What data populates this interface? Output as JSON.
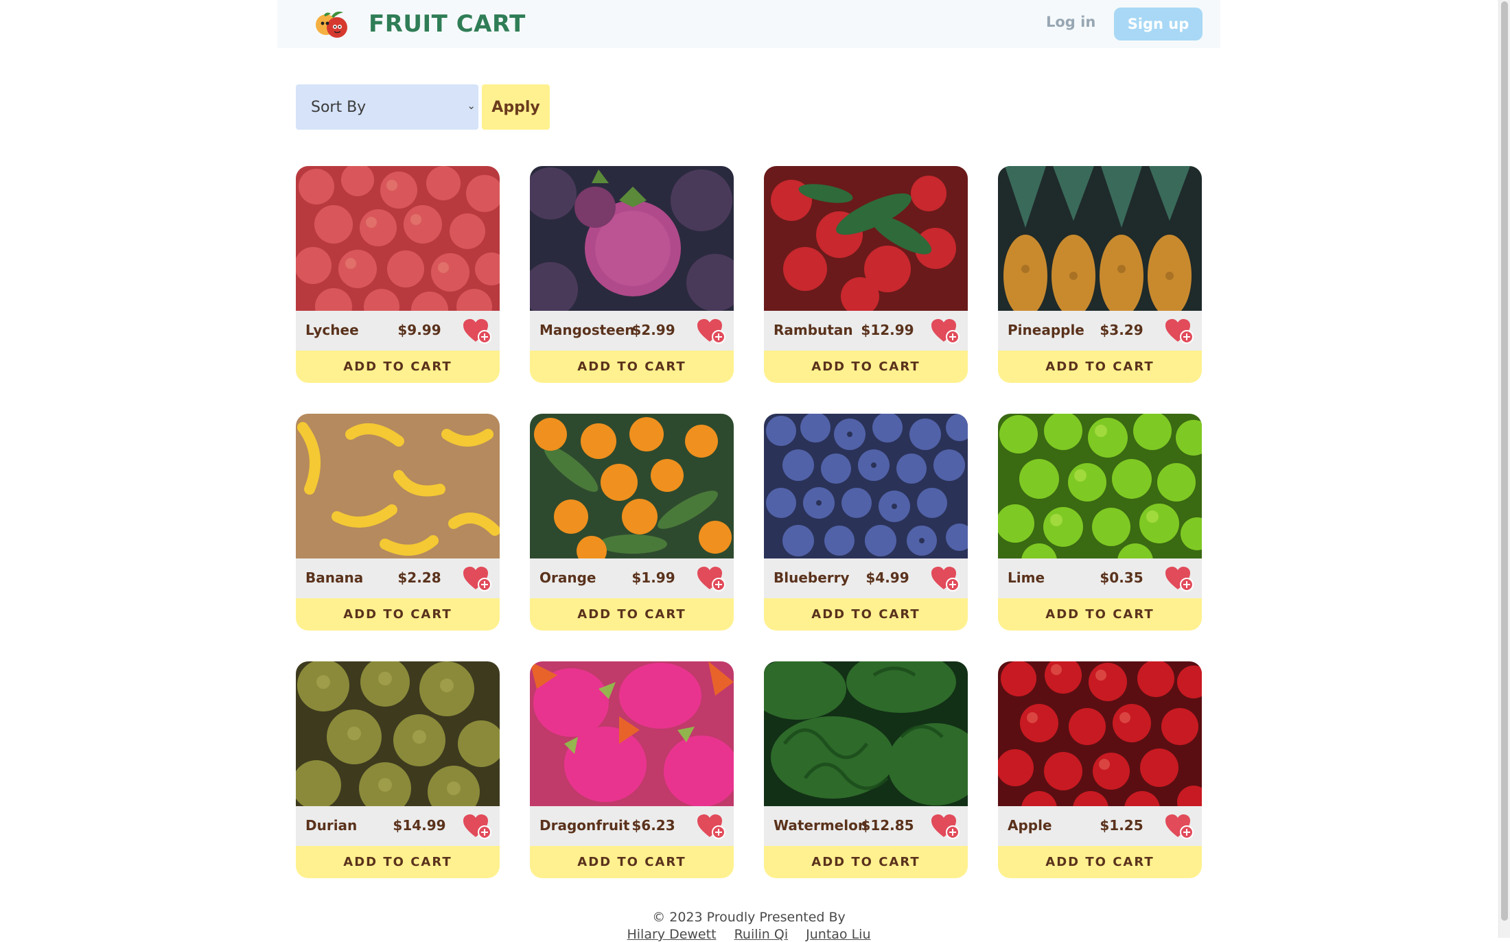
{
  "header": {
    "brand": "FRUIT CART",
    "login_label": "Log in",
    "signup_label": "Sign up"
  },
  "controls": {
    "sort_value": "Sort By",
    "apply_label": "Apply"
  },
  "colors": {
    "brand": "#2f7d56",
    "accent_yellow": "#fff18f",
    "signup_blue": "#a8d8f5",
    "text_brown": "#5a321c",
    "heart_red": "#e14b5a"
  },
  "products": [
    {
      "name": "Lychee",
      "price": "$9.99",
      "cart_label": "ADD TO CART"
    },
    {
      "name": "Mangosteen",
      "price": "$2.99",
      "cart_label": "ADD TO CART"
    },
    {
      "name": "Rambutan",
      "price": "$12.99",
      "cart_label": "ADD TO CART"
    },
    {
      "name": "Pineapple",
      "price": "$3.29",
      "cart_label": "ADD TO CART"
    },
    {
      "name": "Banana",
      "price": "$2.28",
      "cart_label": "ADD TO CART"
    },
    {
      "name": "Orange",
      "price": "$1.99",
      "cart_label": "ADD TO CART"
    },
    {
      "name": "Blueberry",
      "price": "$4.99",
      "cart_label": "ADD TO CART"
    },
    {
      "name": "Lime",
      "price": "$0.35",
      "cart_label": "ADD TO CART"
    },
    {
      "name": "Durian",
      "price": "$14.99",
      "cart_label": "ADD TO CART"
    },
    {
      "name": "Dragonfruit",
      "price": "$6.23",
      "cart_label": "ADD TO CART"
    },
    {
      "name": "Watermelon",
      "price": "$12.85",
      "cart_label": "ADD TO CART"
    },
    {
      "name": "Apple",
      "price": "$1.25",
      "cart_label": "ADD TO CART"
    }
  ],
  "footer": {
    "copyright": "© 2023 Proudly Presented By",
    "authors": [
      "Hilary Dewett",
      "Ruilin Qi",
      "Juntao Liu"
    ]
  }
}
